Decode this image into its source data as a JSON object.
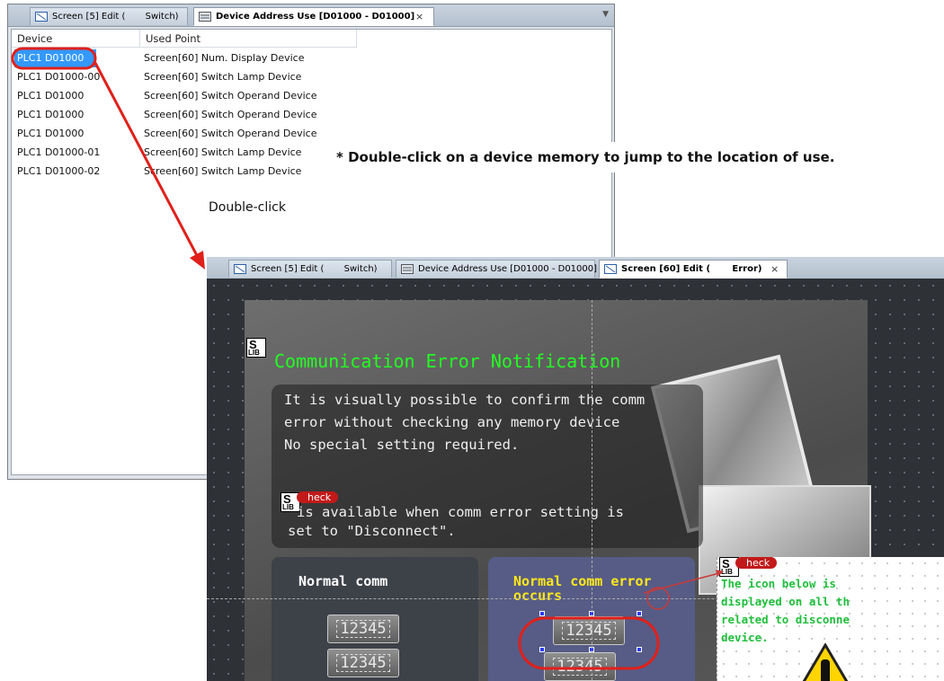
{
  "window1": {
    "tabs": [
      {
        "label": "Screen [5] Edit (       Switch)"
      },
      {
        "label": "Device Address Use [D01000 - D01000]",
        "close": "×"
      }
    ],
    "columns": {
      "device": "Device",
      "used_point": "Used Point"
    },
    "rows": [
      {
        "device": "PLC1  D01000",
        "used": "Screen[60] Num. Display Device"
      },
      {
        "device": "PLC1  D01000-00",
        "used": "Screen[60] Switch Lamp Device"
      },
      {
        "device": "PLC1  D01000",
        "used": "Screen[60] Switch Operand Device"
      },
      {
        "device": "PLC1  D01000",
        "used": "Screen[60] Switch Operand Device"
      },
      {
        "device": "PLC1  D01000",
        "used": "Screen[60] Switch Operand Device"
      },
      {
        "device": "PLC1  D01000-01",
        "used": "Screen[60] Switch Lamp Device"
      },
      {
        "device": "PLC1  D01000-02",
        "used": "Screen[60] Switch Lamp Device"
      }
    ]
  },
  "annotations": {
    "note": "*  Double-click on a device memory to jump to the location of use.",
    "double_click": "Double-click"
  },
  "window2": {
    "tabs": [
      {
        "label": "Screen [5] Edit (       Switch)"
      },
      {
        "label": "Device Address Use [D01000 - D01000]"
      },
      {
        "label": "Screen [60] Edit (       Error)",
        "close": "×"
      }
    ],
    "screen": {
      "title": "Communication Error Notification",
      "info_lines": [
        "It is visually possible to confirm the comm",
        "error without checking any memory device",
        "No special setting required."
      ],
      "check_label": "heck",
      "check_line1": " is available when comm error setting is",
      "check_line2": "set to \"Disconnect\".",
      "panel_left_label": "Normal comm",
      "panel_right_label_1": "Normal comm error",
      "panel_right_label_2": "occurs",
      "num_value": "12345",
      "slib_s": "S",
      "slib_lib": "LIB"
    },
    "side_note": {
      "check_label": "heck",
      "lines": [
        "The icon below is",
        "displayed on all th",
        "related to disconne",
        "device."
      ]
    }
  },
  "colors": {
    "accent_red": "#e0201a",
    "selection": "#3399ff",
    "title_green": "#22ff22"
  }
}
